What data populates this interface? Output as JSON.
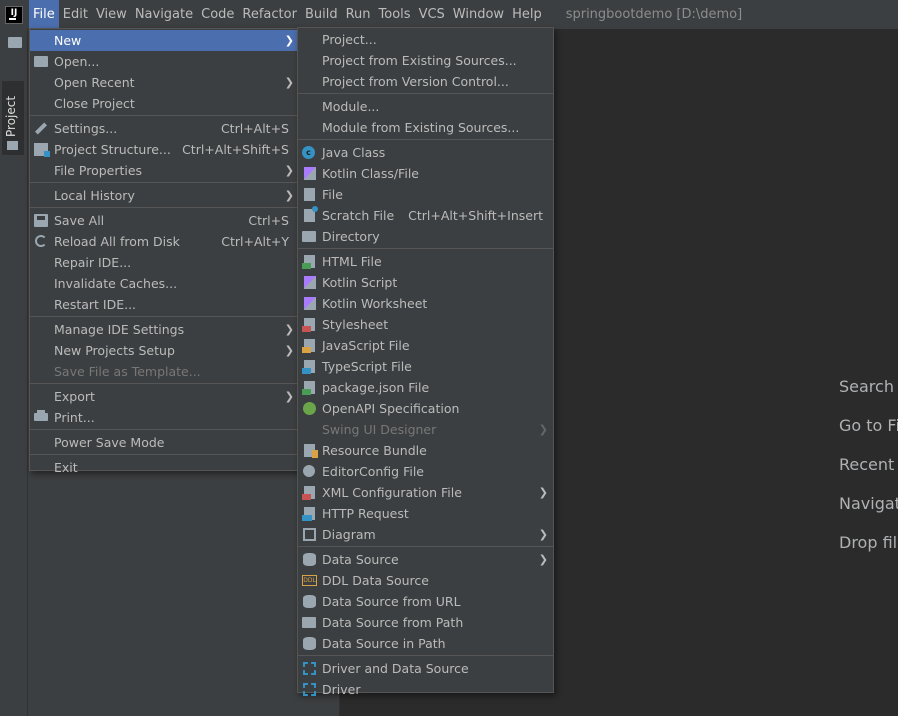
{
  "menubar": {
    "logo": "IJ",
    "items": [
      "File",
      "Edit",
      "View",
      "Navigate",
      "Code",
      "Refactor",
      "Build",
      "Run",
      "Tools",
      "VCS",
      "Window",
      "Help"
    ],
    "window_title": "springbootdemo [D:\\demo]"
  },
  "project_tab": {
    "label": "Project"
  },
  "hints": [
    "Search E",
    "Go to Fi",
    "Recent",
    "Navigat",
    "Drop file"
  ],
  "file_menu": {
    "groups": [
      [
        {
          "label": "New",
          "submenu": true,
          "selected": true
        },
        {
          "label": "Open...",
          "icon": "folder-icon"
        },
        {
          "label": "Open Recent",
          "submenu": true
        },
        {
          "label": "Close Project"
        }
      ],
      [
        {
          "label": "Settings...",
          "shortcut": "Ctrl+Alt+S",
          "icon": "wrench-icon"
        },
        {
          "label": "Project Structure...",
          "shortcut": "Ctrl+Alt+Shift+S",
          "icon": "project-structure-icon"
        },
        {
          "label": "File Properties",
          "submenu": true
        }
      ],
      [
        {
          "label": "Local History",
          "submenu": true
        }
      ],
      [
        {
          "label": "Save All",
          "shortcut": "Ctrl+S",
          "icon": "save-icon"
        },
        {
          "label": "Reload All from Disk",
          "shortcut": "Ctrl+Alt+Y",
          "icon": "reload-icon"
        },
        {
          "label": "Repair IDE..."
        },
        {
          "label": "Invalidate Caches..."
        },
        {
          "label": "Restart IDE..."
        }
      ],
      [
        {
          "label": "Manage IDE Settings",
          "submenu": true
        },
        {
          "label": "New Projects Setup",
          "submenu": true
        },
        {
          "label": "Save File as Template...",
          "disabled": true
        }
      ],
      [
        {
          "label": "Export",
          "submenu": true
        },
        {
          "label": "Print...",
          "icon": "print-icon"
        }
      ],
      [
        {
          "label": "Power Save Mode"
        }
      ],
      [
        {
          "label": "Exit"
        }
      ]
    ]
  },
  "new_menu": {
    "groups": [
      [
        {
          "label": "Project..."
        },
        {
          "label": "Project from Existing Sources..."
        },
        {
          "label": "Project from Version Control..."
        }
      ],
      [
        {
          "label": "Module..."
        },
        {
          "label": "Module from Existing Sources..."
        }
      ],
      [
        {
          "label": "Java Class",
          "icon": "java-class-icon"
        },
        {
          "label": "Kotlin Class/File",
          "icon": "kotlin-file-icon"
        },
        {
          "label": "File",
          "icon": "file-icon"
        },
        {
          "label": "Scratch File",
          "shortcut": "Ctrl+Alt+Shift+Insert",
          "icon": "scratch-file-icon"
        },
        {
          "label": "Directory",
          "icon": "folder-icon"
        }
      ],
      [
        {
          "label": "HTML File",
          "icon": "html-file-icon",
          "tag_color": "#499c54"
        },
        {
          "label": "Kotlin Script",
          "icon": "kotlin-script-icon"
        },
        {
          "label": "Kotlin Worksheet",
          "icon": "kotlin-worksheet-icon"
        },
        {
          "label": "Stylesheet",
          "icon": "css-file-icon",
          "tag_color": "#c75450"
        },
        {
          "label": "JavaScript File",
          "icon": "js-file-icon",
          "tag_color": "#d9a343"
        },
        {
          "label": "TypeScript File",
          "icon": "ts-file-icon",
          "tag_color": "#3592c4"
        },
        {
          "label": "package.json File",
          "icon": "package-json-icon"
        },
        {
          "label": "OpenAPI Specification",
          "icon": "openapi-icon"
        },
        {
          "label": "Swing UI Designer",
          "submenu": true,
          "disabled": true
        },
        {
          "label": "Resource Bundle",
          "icon": "resource-bundle-icon"
        },
        {
          "label": "EditorConfig File",
          "icon": "gear-icon"
        },
        {
          "label": "XML Configuration File",
          "submenu": true,
          "icon": "xml-file-icon",
          "tag_color": "#c75450"
        },
        {
          "label": "HTTP Request",
          "icon": "http-request-icon"
        },
        {
          "label": "Diagram",
          "submenu": true,
          "icon": "diagram-icon"
        }
      ],
      [
        {
          "label": "Data Source",
          "submenu": true,
          "icon": "database-icon"
        },
        {
          "label": "DDL Data Source",
          "icon": "ddl-icon"
        },
        {
          "label": "Data Source from URL",
          "icon": "database-url-icon"
        },
        {
          "label": "Data Source from Path",
          "icon": "database-folder-icon"
        },
        {
          "label": "Data Source in Path",
          "icon": "database-path-icon"
        }
      ],
      [
        {
          "label": "Driver and Data Source",
          "icon": "driver-icon"
        },
        {
          "label": "Driver",
          "icon": "driver-icon"
        }
      ]
    ]
  }
}
